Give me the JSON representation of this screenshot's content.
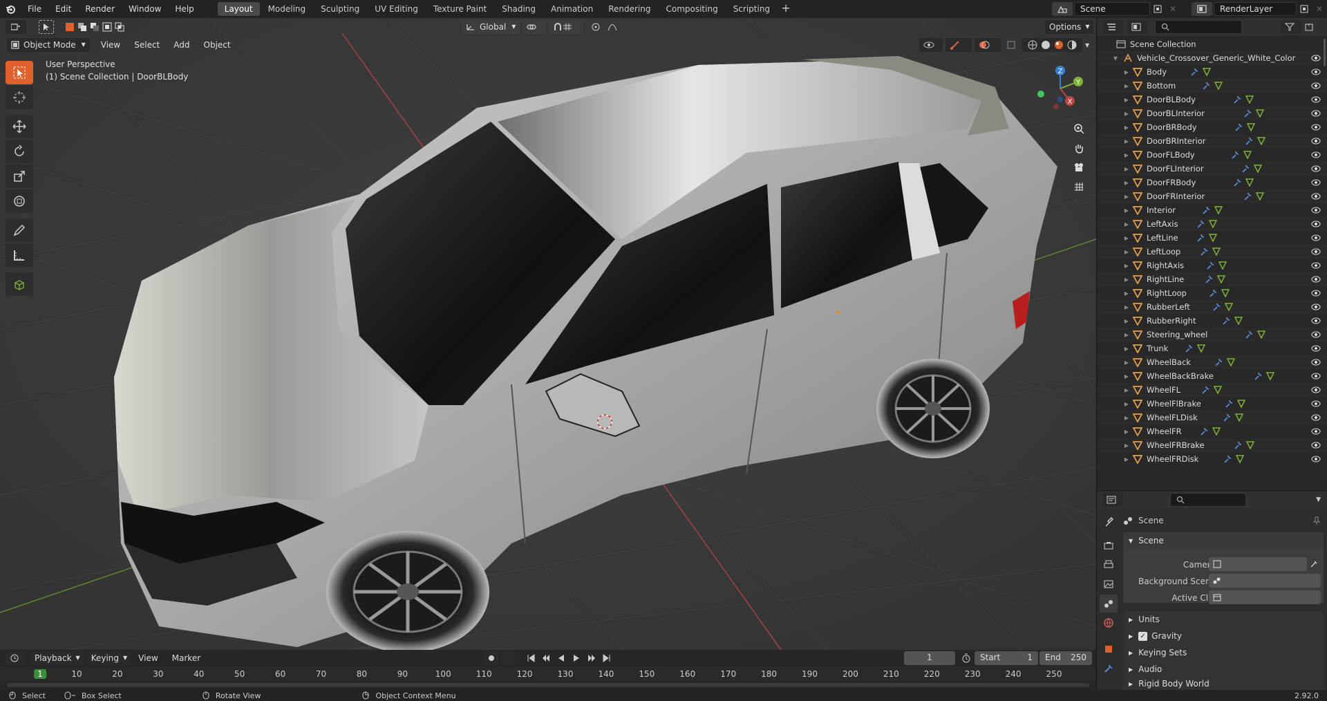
{
  "topbar": {
    "menus": [
      "File",
      "Edit",
      "Render",
      "Window",
      "Help"
    ],
    "workspaces": [
      "Layout",
      "Modeling",
      "Sculpting",
      "UV Editing",
      "Texture Paint",
      "Shading",
      "Animation",
      "Rendering",
      "Compositing",
      "Scripting"
    ],
    "active_workspace": "Layout",
    "scene_name": "Scene",
    "view_layer": "RenderLayer"
  },
  "viewport": {
    "mode": "Object Mode",
    "menus": [
      "View",
      "Select",
      "Add",
      "Object"
    ],
    "transform_orientation": "Global",
    "options_label": "Options",
    "perspective_label": "User Perspective",
    "context_label": "(1) Scene Collection | DoorBLBody",
    "gizmo_labels": {
      "z": "Z",
      "y": "Y",
      "x": "X"
    },
    "colors": {
      "x_axis": "#c04545",
      "y_axis": "#7fb236",
      "z_axis": "#3b7ed6",
      "active_tool": "#e0612c"
    }
  },
  "outliner": {
    "root": "Scene Collection",
    "collection": "Vehicle_Crossover_Generic_White_Color",
    "objects": [
      "Body",
      "Bottom",
      "DoorBLBody",
      "DoorBLInterior",
      "DoorBRBody",
      "DoorBRInterior",
      "DoorFLBody",
      "DoorFLInterior",
      "DoorFRBody",
      "DoorFRInterior",
      "Interior",
      "LeftAxis",
      "LeftLine",
      "LeftLoop",
      "RightAxis",
      "RightLine",
      "RightLoop",
      "RubberLeft",
      "RubberRight",
      "Steering_wheel",
      "Trunk",
      "WheelBack",
      "WheelBackBrake",
      "WheelFL",
      "WheelFlBrake",
      "WheelFLDisk",
      "WheelFR",
      "WheelFRBrake",
      "WheelFRDisk"
    ],
    "selected": "DoorBLBody"
  },
  "properties": {
    "header": "Scene",
    "panel": "Scene",
    "fields": {
      "camera": "Camera",
      "background_scene": "Background Scene",
      "active_clip": "Active Clip"
    },
    "sections": [
      "Units",
      "Gravity",
      "Keying Sets",
      "Audio",
      "Rigid Body World"
    ],
    "gravity_checked": true
  },
  "timeline": {
    "menus": [
      "Playback",
      "Keying",
      "View",
      "Marker"
    ],
    "current_frame": "1",
    "start_label": "Start",
    "start": "1",
    "end_label": "End",
    "end": "250",
    "ticks": [
      "1",
      "10",
      "20",
      "30",
      "40",
      "50",
      "60",
      "70",
      "80",
      "90",
      "100",
      "110",
      "120",
      "130",
      "140",
      "150",
      "160",
      "170",
      "180",
      "190",
      "200",
      "210",
      "220",
      "230",
      "240",
      "250"
    ]
  },
  "statusbar": {
    "select": "Select",
    "box_select": "Box Select",
    "rotate": "Rotate View",
    "context_menu": "Object Context Menu",
    "version": "2.92.0"
  }
}
